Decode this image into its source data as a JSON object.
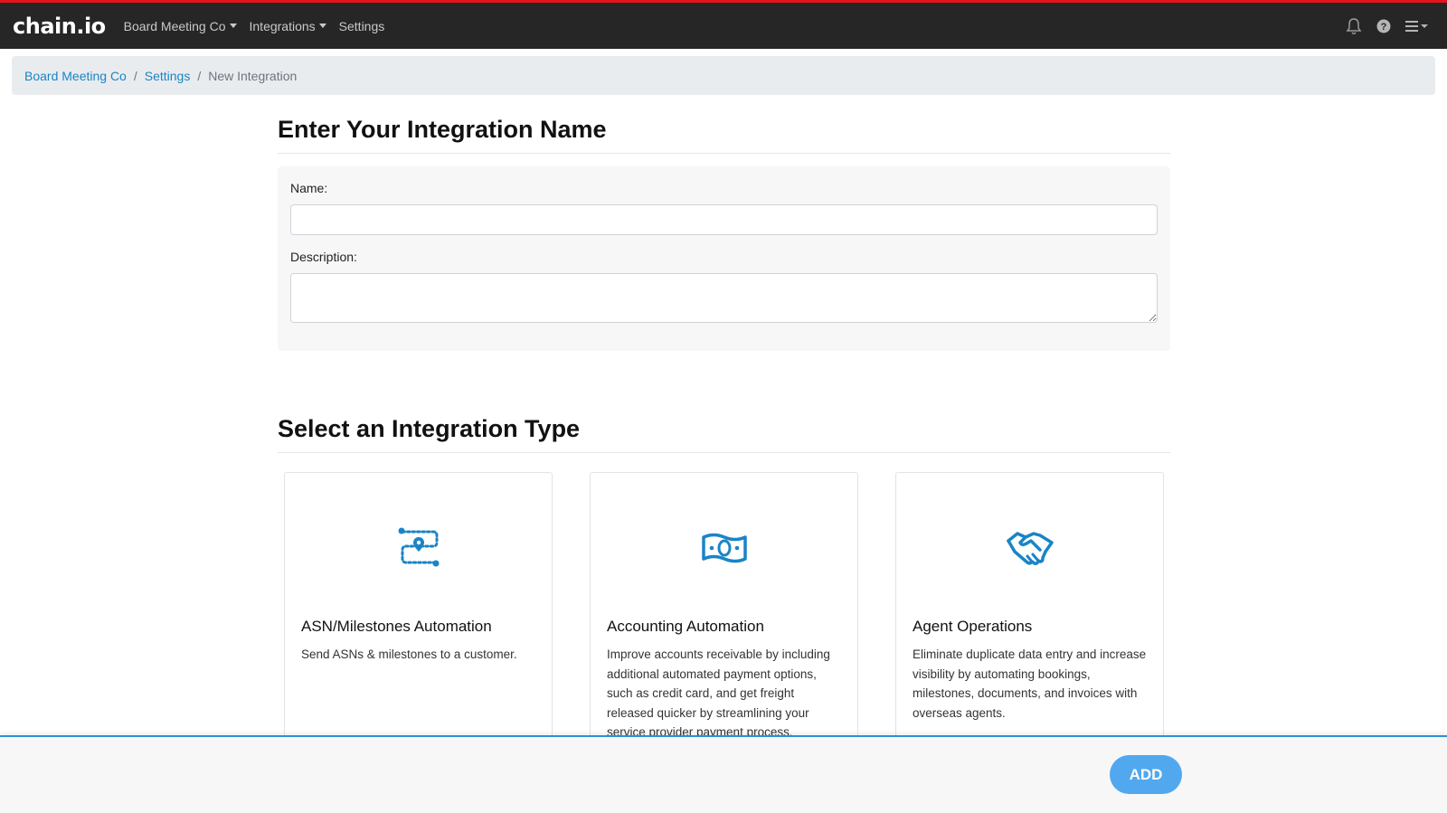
{
  "app": {
    "brand": "chain.io"
  },
  "navbar": {
    "items": [
      {
        "label": "Board Meeting Co",
        "dropdown": true
      },
      {
        "label": "Integrations",
        "dropdown": true
      },
      {
        "label": "Settings",
        "dropdown": false
      }
    ],
    "icons": [
      "bell-icon",
      "help-circle-icon",
      "hamburger-menu-icon"
    ]
  },
  "breadcrumb": {
    "items": [
      "Board Meeting Co",
      "Settings"
    ],
    "active": "New Integration"
  },
  "name_section": {
    "title": "Enter Your Integration Name",
    "name_label": "Name:",
    "name_value": "",
    "description_label": "Description:",
    "description_value": ""
  },
  "type_section": {
    "title": "Select an Integration Type",
    "cards": [
      {
        "icon": "route-pin-icon",
        "title": "ASN/Milestones Automation",
        "description": "Send ASNs & milestones to a customer."
      },
      {
        "icon": "money-bill-icon",
        "title": "Accounting Automation",
        "description": "Improve accounts receivable by including additional automated payment options, such as credit card, and get freight released quicker by streamlining your service provider payment process."
      },
      {
        "icon": "handshake-icon",
        "title": "Agent Operations",
        "description": "Eliminate duplicate data entry and increase visibility by automating bookings, milestones, documents, and invoices with overseas agents."
      }
    ]
  },
  "footer": {
    "add_label": "ADD"
  },
  "colors": {
    "accent": "#1a84c6",
    "top_line": "#e3141b",
    "navbar": "#262626",
    "add_button": "#52a8ee"
  }
}
